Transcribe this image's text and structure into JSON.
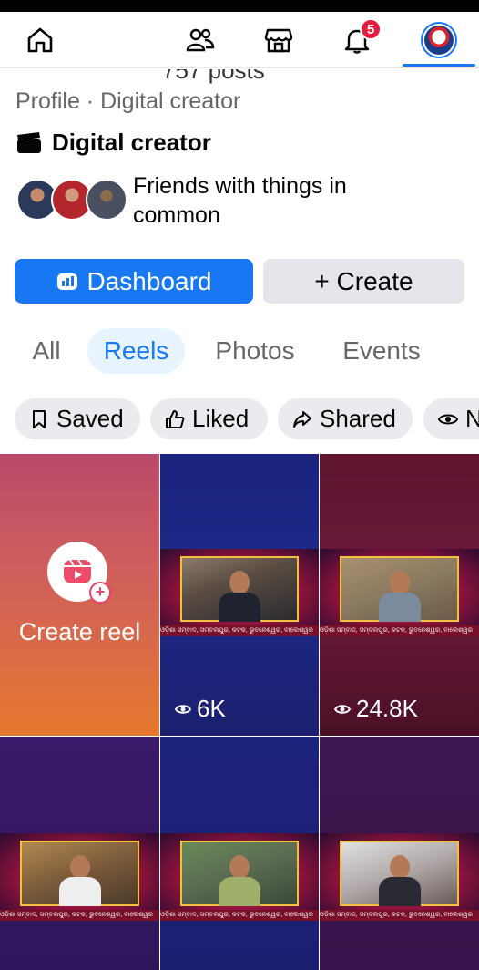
{
  "nav": {
    "notification_count": "5"
  },
  "header": {
    "posts_cutoff": "757 posts",
    "profile_line": "Profile · Digital creator",
    "category": "Digital creator",
    "friends_text": "Friends with things in common"
  },
  "actions": {
    "dashboard_label": "Dashboard",
    "create_label": "+ Create"
  },
  "tabs": [
    {
      "label": "All",
      "active": false
    },
    {
      "label": "Reels",
      "active": true
    },
    {
      "label": "Photos",
      "active": false
    },
    {
      "label": "Events",
      "active": false
    }
  ],
  "chips": [
    {
      "label": "Saved",
      "icon": "bookmark-icon"
    },
    {
      "label": "Liked",
      "icon": "thumbs-up-icon"
    },
    {
      "label": "Shared",
      "icon": "share-icon"
    },
    {
      "label": "N",
      "icon": "eye-icon"
    }
  ],
  "grid": {
    "create_reel_label": "Create reel",
    "reels": [
      {
        "views": "6K"
      },
      {
        "views": "24.8K"
      },
      {
        "views": ""
      },
      {
        "views": ""
      },
      {
        "views": ""
      }
    ],
    "ticker_text": "ଓଡ଼ିଶା ସମ୍ବାଦ, ସମ୍ବଲପୁର, କଟକ, ଭୁବନେଶ୍ୱର, ବାଲେଶ୍ୱର"
  },
  "colors": {
    "accent": "#1877f2",
    "badge": "#e41e3f",
    "chip_bg": "#e9ebee",
    "tab_active_bg": "#e7f3ff"
  }
}
